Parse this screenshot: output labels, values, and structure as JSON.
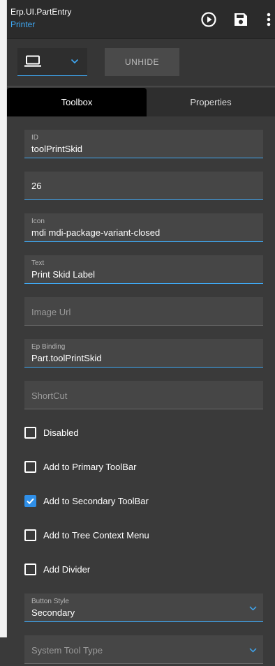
{
  "header": {
    "title": "Erp.UI.PartEntry",
    "subtitle": "Printer",
    "icons": [
      "play-circle-icon",
      "save-icon",
      "more-vert-icon"
    ]
  },
  "toolbar": {
    "device_icon": "laptop-icon",
    "unhide_label": "UNHIDE"
  },
  "tabs": [
    {
      "label": "Toolbox",
      "active": true
    },
    {
      "label": "Properties",
      "active": false
    }
  ],
  "form": {
    "id": {
      "label": "ID",
      "value": "toolPrintSkid"
    },
    "seq": {
      "value": "26"
    },
    "icon": {
      "label": "Icon",
      "value": "mdi mdi-package-variant-closed"
    },
    "text": {
      "label": "Text",
      "value": "Print Skid Label"
    },
    "image_url": {
      "placeholder": "Image Url"
    },
    "ep_binding": {
      "label": "Ep Binding",
      "value": "Part.toolPrintSkid"
    },
    "shortcut": {
      "placeholder": "ShortCut"
    },
    "checkboxes": [
      {
        "label": "Disabled",
        "checked": false
      },
      {
        "label": "Add to Primary ToolBar",
        "checked": false
      },
      {
        "label": "Add to Secondary ToolBar",
        "checked": true
      },
      {
        "label": "Add to Tree Context Menu",
        "checked": false
      },
      {
        "label": "Add Divider",
        "checked": false
      }
    ],
    "button_style": {
      "label": "Button Style",
      "value": "Secondary"
    },
    "system_tool_type": {
      "placeholder": "System Tool Type"
    }
  },
  "colors": {
    "accent": "#3fa9f5",
    "checkbox_checked": "#2f8fe8",
    "panel_bg": "#3a3a3a",
    "field_bg": "#464646"
  }
}
